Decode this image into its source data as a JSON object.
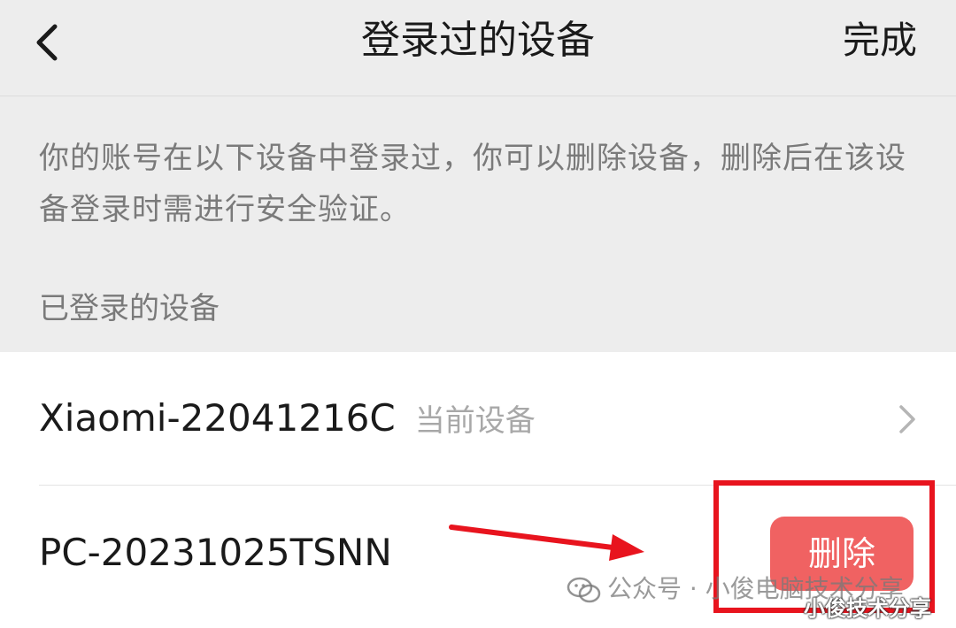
{
  "nav": {
    "title": "登录过的设备",
    "done_label": "完成"
  },
  "description": "你的账号在以下设备中登录过，你可以删除设备，删除后在该设备登录时需进行安全验证。",
  "section_header": "已登录的设备",
  "devices": [
    {
      "name": "Xiaomi-22041216C",
      "tag": "当前设备"
    },
    {
      "name": "PC-20231025TSNN",
      "action_label": "删除"
    }
  ],
  "watermarks": {
    "primary": "公众号 · 小俊电脑技术分享",
    "secondary": "小俊技术分享"
  },
  "colors": {
    "background": "#ededed",
    "delete_button": "#f06262",
    "highlight": "#e8141e"
  }
}
